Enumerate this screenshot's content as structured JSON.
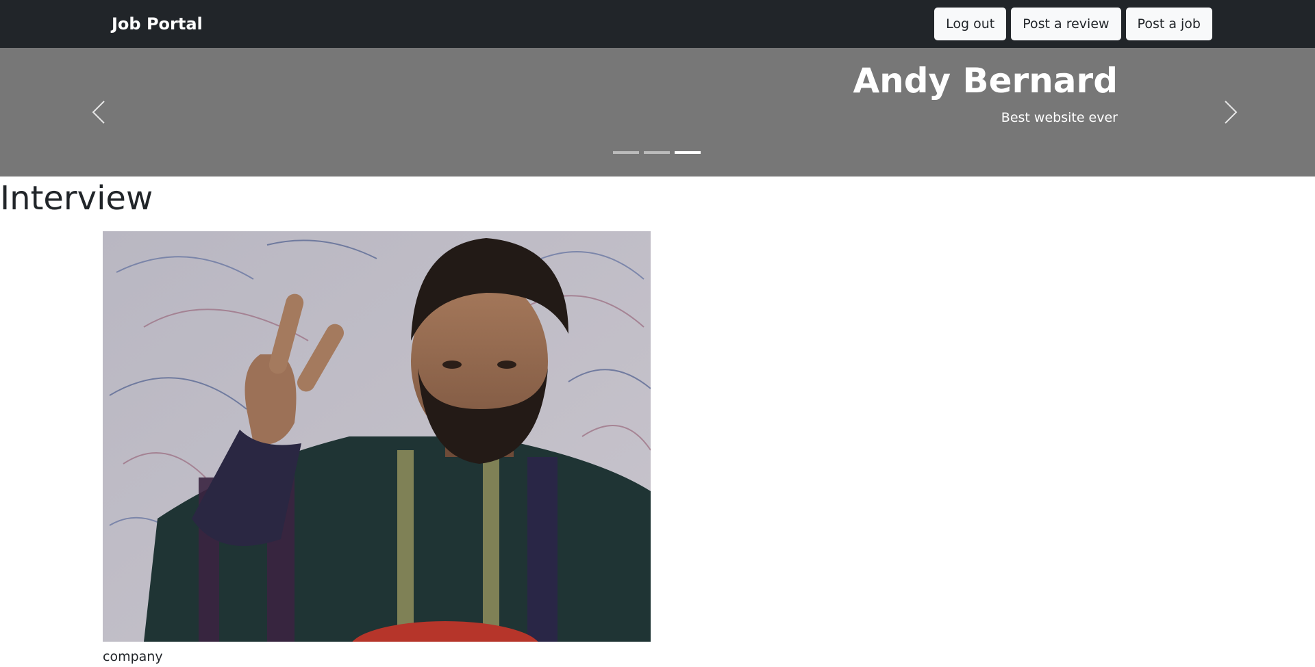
{
  "navbar": {
    "brand": "Job Portal",
    "buttons": {
      "logout": "Log out",
      "post_review": "Post a review",
      "post_job": "Post a job"
    }
  },
  "carousel": {
    "title": "Andy Bernard",
    "text": "Best website ever",
    "slide_count": 3,
    "active_index": 2,
    "prev_icon": "chevron-left-icon",
    "next_icon": "chevron-right-icon"
  },
  "main": {
    "heading": "Interview",
    "image_caption": "company"
  },
  "colors": {
    "navbar_bg": "#212529",
    "carousel_bg": "#777777",
    "button_bg": "#f8f9fa"
  }
}
